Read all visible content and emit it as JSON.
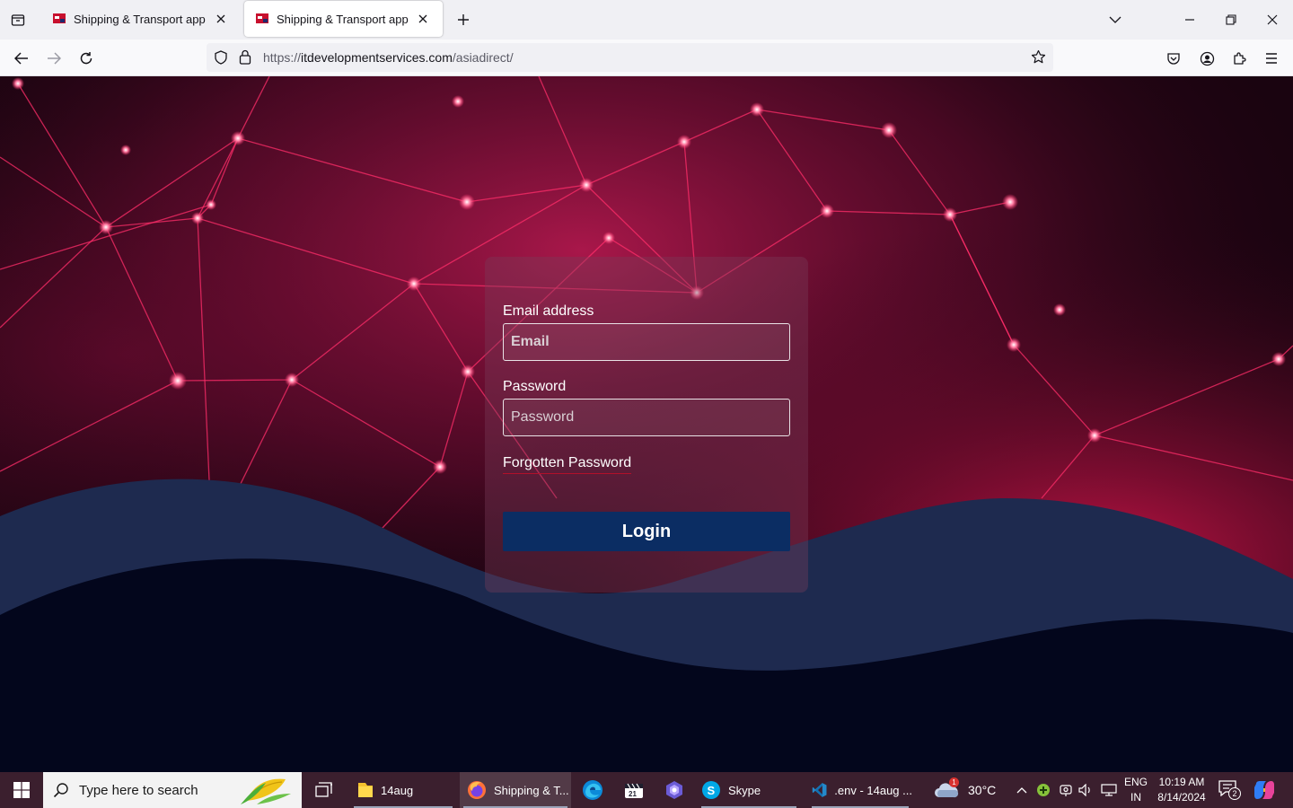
{
  "browser": {
    "tabs": [
      {
        "title": "Shipping & Transport app",
        "active": false
      },
      {
        "title": "Shipping & Transport app",
        "active": true
      }
    ],
    "url_prefix": "https://",
    "url_host": "itdevelopmentservices.com",
    "url_path": "/asiadirect/"
  },
  "login": {
    "email_label": "Email address",
    "email_placeholder": "Email",
    "password_label": "Password",
    "password_placeholder": "Password",
    "forgot_label": "Forgotten Password",
    "login_label": "Login"
  },
  "taskbar": {
    "search_placeholder": "Type here to search",
    "items": [
      {
        "label": "14aug",
        "icon": "folder-icon"
      },
      {
        "label": "Shipping & T...",
        "icon": "firefox-icon"
      },
      {
        "label": "",
        "icon": "edge-icon"
      },
      {
        "label": "",
        "icon": "video-editor-icon"
      },
      {
        "label": "",
        "icon": "copilot-icon"
      },
      {
        "label": "Skype",
        "icon": "skype-icon"
      },
      {
        "label": ".env - 14aug ...",
        "icon": "vscode-icon"
      }
    ],
    "weather": {
      "temp": "30°C",
      "badge": "1"
    },
    "language": {
      "line1": "ENG",
      "line2": "IN"
    },
    "clock": {
      "time": "10:19 AM",
      "date": "8/14/2024"
    },
    "notifications": "2"
  },
  "colors": {
    "accent_navy": "#0b2d63",
    "wave_light": "#1e2a4f",
    "wave_dark": "#03061c",
    "network_pink": "#ff2d6a"
  }
}
